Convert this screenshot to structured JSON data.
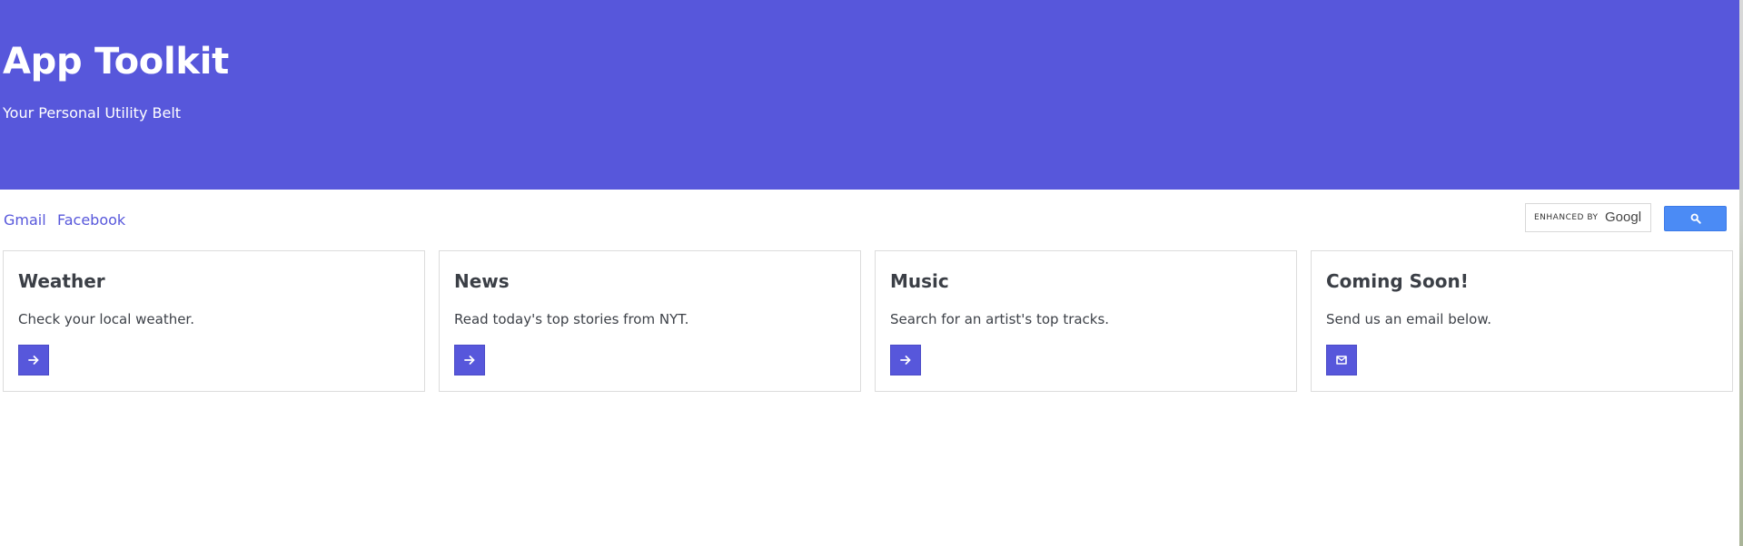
{
  "header": {
    "title": "App Toolkit",
    "subtitle": "Your Personal Utility Belt"
  },
  "nav": {
    "links": [
      {
        "label": "Gmail"
      },
      {
        "label": "Facebook"
      }
    ]
  },
  "search": {
    "branding_text": "ENHANCED BY",
    "provider_text": "Googl",
    "button_icon": "search-icon"
  },
  "cards": [
    {
      "title": "Weather",
      "description": "Check your local weather.",
      "button_icon": "arrow-right-icon"
    },
    {
      "title": "News",
      "description": "Read today's top stories from NYT.",
      "button_icon": "arrow-right-icon"
    },
    {
      "title": "Music",
      "description": "Search for an artist's top tracks.",
      "button_icon": "arrow-right-icon"
    },
    {
      "title": "Coming Soon!",
      "description": "Send us an email below.",
      "button_icon": "mail-icon"
    }
  ],
  "colors": {
    "primary": "#5757db",
    "link": "#5757db",
    "search_button": "#4b8bf5",
    "card_border": "#dcdcdc",
    "text_dark": "#3b3f46"
  }
}
